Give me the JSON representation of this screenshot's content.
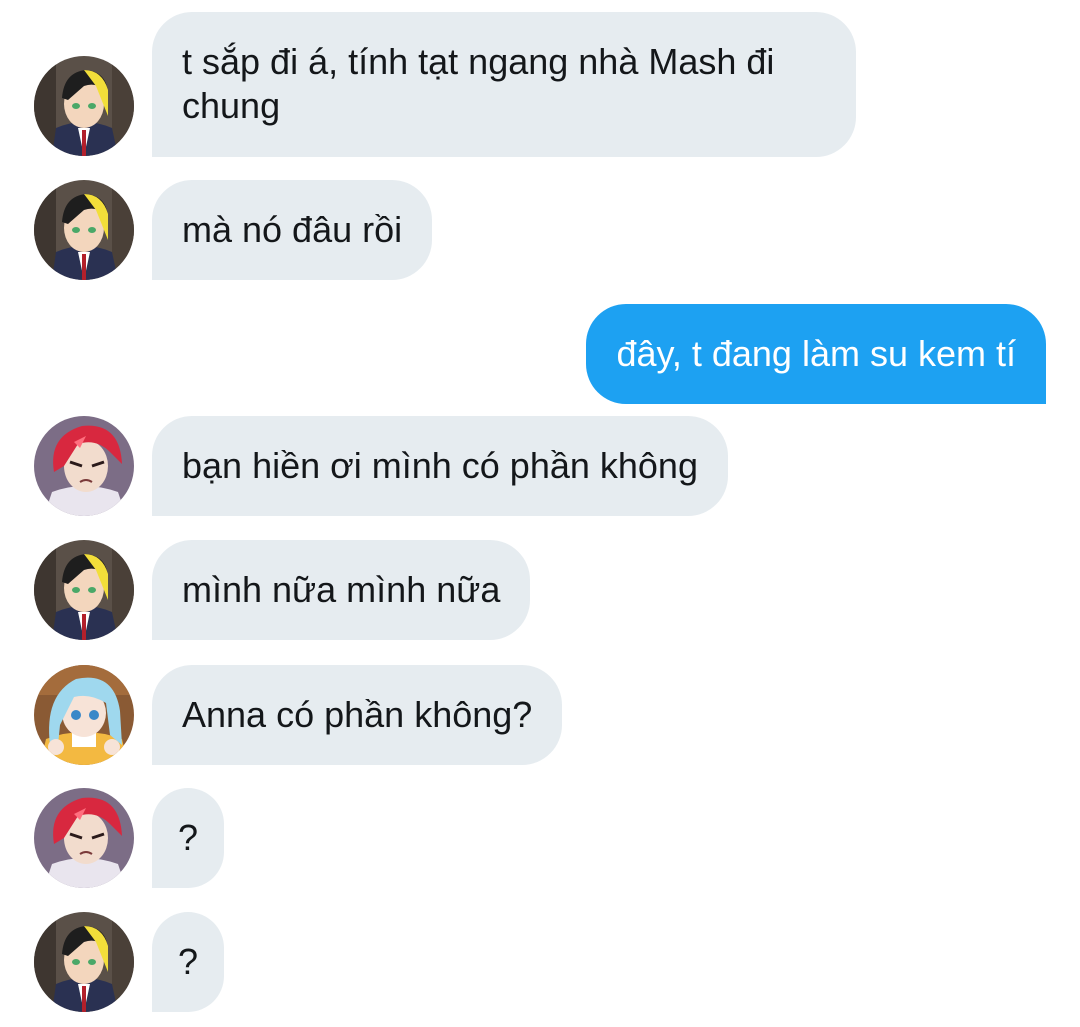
{
  "messages": [
    {
      "sender": "boy-green",
      "text": "t sắp đi á, tính tạt ngang nhà Mash đi chung"
    },
    {
      "sender": "boy-green",
      "text": "mà nó đâu rồi"
    },
    {
      "sender": "me",
      "text": "đây, t đang làm su kem tí"
    },
    {
      "sender": "boy-red",
      "text": "bạn hiền ơi mình có phần không"
    },
    {
      "sender": "boy-green",
      "text": "mình nữa mình nữa"
    },
    {
      "sender": "girl-blue",
      "text": "Anna có phần không?"
    },
    {
      "sender": "boy-red",
      "text": "?"
    },
    {
      "sender": "boy-green",
      "text": "?"
    }
  ],
  "colors": {
    "incoming_bubble": "#e6ecf0",
    "outgoing_bubble": "#1da1f2",
    "incoming_text": "#14171a",
    "outgoing_text": "#ffffff"
  },
  "icons": {
    "boy-green": "avatar-green-eyed-boy-icon",
    "boy-red": "avatar-red-haired-boy-icon",
    "girl-blue": "avatar-blue-haired-girl-icon"
  }
}
